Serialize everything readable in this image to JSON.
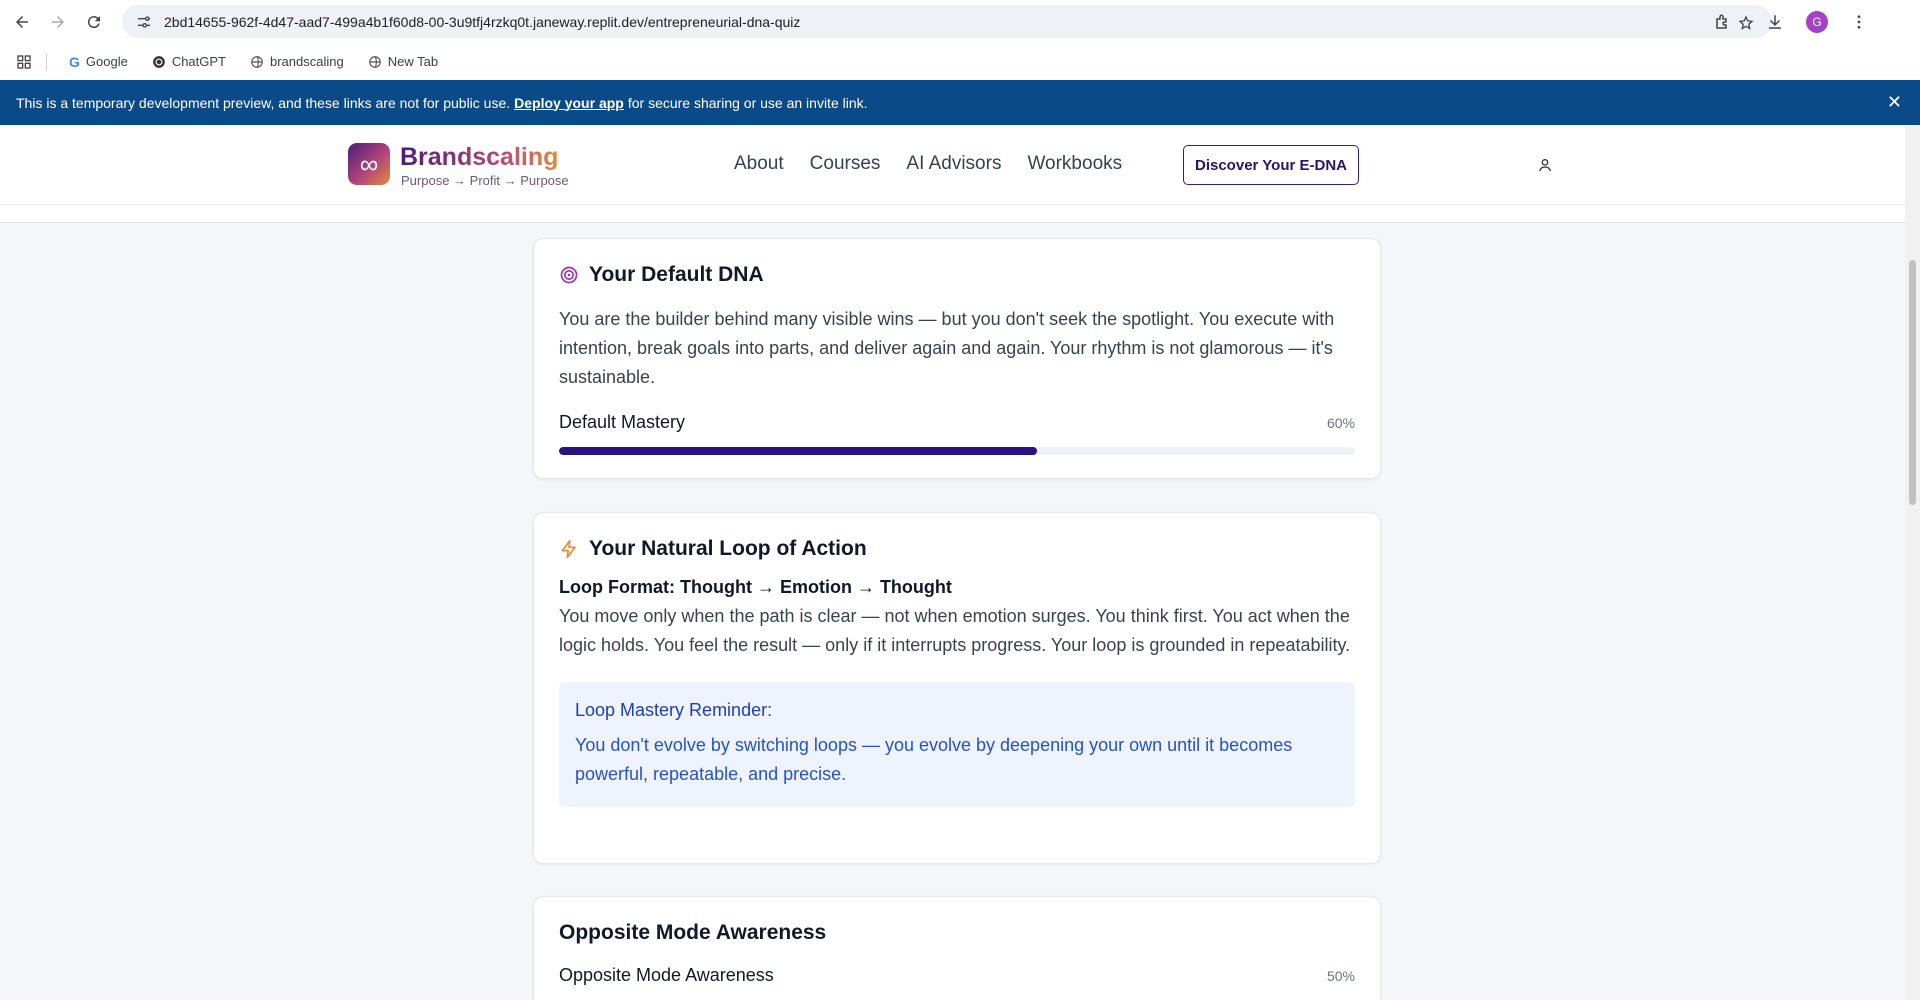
{
  "browser": {
    "url": "2bd14655-962f-4d47-aad7-499a4b1f60d8-00-3u9tfj4rzkq0t.janeway.replit.dev/entrepreneurial-dna-quiz",
    "avatar_letter": "G",
    "bookmarks": [
      "Google",
      "ChatGPT",
      "brandscaling",
      "New Tab"
    ]
  },
  "banner": {
    "text_before": "This is a temporary development preview, and these links are not for public use.",
    "link": "Deploy your app",
    "text_after": "for secure sharing or use an invite link.",
    "close": "✕"
  },
  "header": {
    "logo_glyph": "∞",
    "brand": "Brandscaling",
    "tagline": "Purpose → Profit → Purpose",
    "nav": [
      "About",
      "Courses",
      "AI Advisors",
      "Workbooks"
    ],
    "cta": "Discover Your E-DNA"
  },
  "default_dna": {
    "title": "Your Default DNA",
    "body": "You are the builder behind many visible wins — but you don't seek the spotlight. You execute with intention, break goals into parts, and deliver again and again. Your rhythm is not glamorous — it's sustainable.",
    "metric_label": "Default Mastery",
    "metric_pct": "60%",
    "metric_value": 60,
    "icon_color": "#9b2fb5"
  },
  "loop": {
    "title": "Your Natural Loop of Action",
    "format": "Loop Format: Thought → Emotion → Thought",
    "body": "You move only when the path is clear — not when emotion surges. You think first. You act when the logic holds. You feel the result — only if it interrupts progress. Your loop is grounded in repeatability.",
    "reminder_title": "Loop Mastery Reminder:",
    "reminder_text": "You don't evolve by switching loops — you evolve by deepening your own until it becomes powerful, repeatable, and precise.",
    "icon_color": "#f08a2c"
  },
  "opposite": {
    "title": "Opposite Mode Awareness",
    "metric_label": "Opposite Mode Awareness",
    "metric_pct": "50%",
    "metric_value": 50
  },
  "colors": {
    "banner_bg": "#0b4a88",
    "bar_fill": "#2a1185",
    "reminder_bg": "#eef3fd",
    "reminder_text": "#2553c4"
  }
}
